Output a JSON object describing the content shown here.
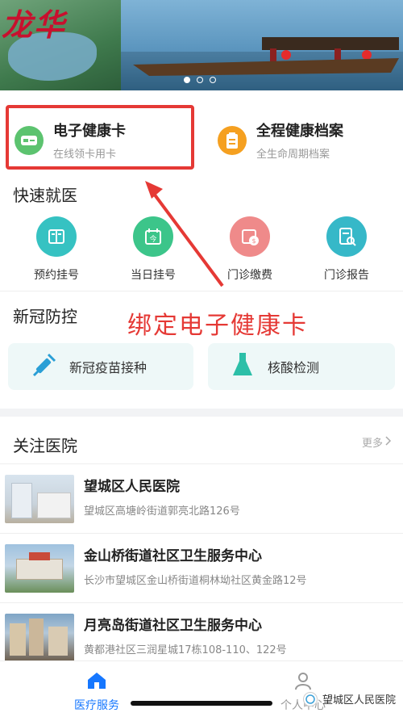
{
  "banner": {
    "title": "龙华",
    "dots": [
      true,
      false,
      false
    ]
  },
  "health_cards": [
    {
      "title": "电子健康卡",
      "subtitle": "在线领卡用卡",
      "icon": "card-icon",
      "color": "#5cc36f"
    },
    {
      "title": "全程健康档案",
      "subtitle": "全生命周期档案",
      "icon": "clipboard-icon",
      "color": "#f5a020"
    }
  ],
  "quick": {
    "title": "快速就医",
    "items": [
      {
        "label": "预约挂号",
        "icon": "appointment-icon",
        "color": "#36c2c2"
      },
      {
        "label": "当日挂号",
        "icon": "calendar-today-icon",
        "color": "#3cc58a"
      },
      {
        "label": "门诊缴费",
        "icon": "payment-icon",
        "color": "#ef8a8a"
      },
      {
        "label": "门诊报告",
        "icon": "report-icon",
        "color": "#36b8c8"
      }
    ]
  },
  "covid": {
    "title": "新冠防控",
    "items": [
      {
        "label": "新冠疫苗接种",
        "icon": "syringe-icon"
      },
      {
        "label": "核酸检测",
        "icon": "flask-icon"
      }
    ]
  },
  "annotation": "绑定电子健康卡",
  "hospitals": {
    "title": "关注医院",
    "more": "更多",
    "items": [
      {
        "name": "望城区人民医院",
        "address": "望城区高塘岭街道郭亮北路126号"
      },
      {
        "name": "金山桥街道社区卫生服务中心",
        "address": "长沙市望城区金山桥街道桐林坳社区黄金路12号"
      },
      {
        "name": "月亮岛街道社区卫生服务中心",
        "address": "黄都港社区三润星城17栋108-110、122号"
      }
    ]
  },
  "nav": {
    "items": [
      {
        "label": "医疗服务",
        "icon": "home-icon",
        "active": true
      },
      {
        "label": "个人中心",
        "icon": "user-icon",
        "active": false
      }
    ]
  },
  "watermark": "望城区人民医院",
  "colors": {
    "accent": "#1aa3a3",
    "highlight": "#e53935"
  }
}
